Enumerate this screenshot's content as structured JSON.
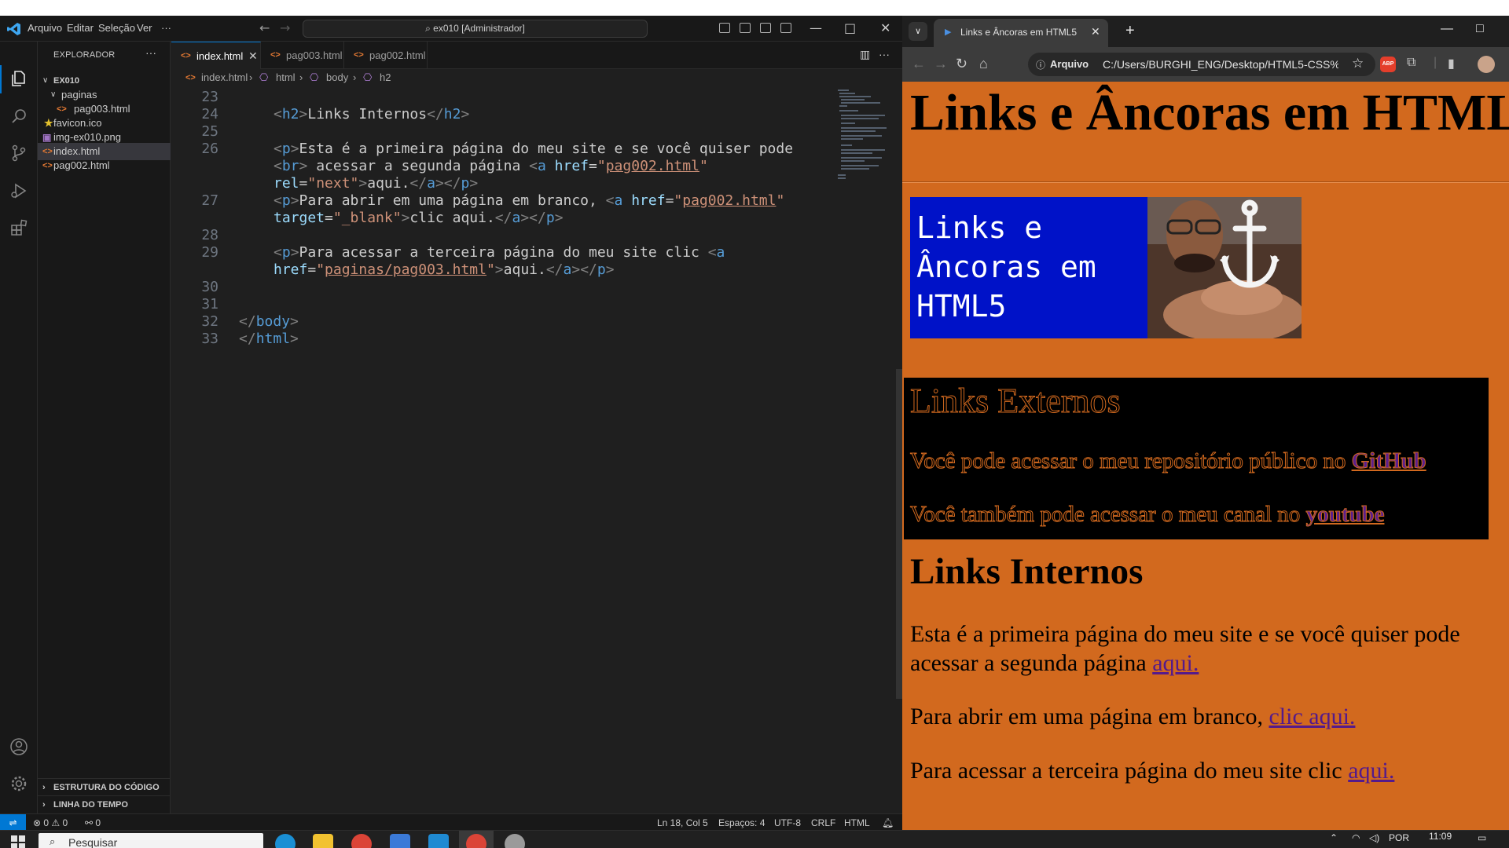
{
  "vscode": {
    "menus": [
      "Arquivo",
      "Editar",
      "Seleção",
      "Ver",
      "···"
    ],
    "search_text": "ex010 [Administrador]",
    "sidebar": {
      "title": "EXPLORADOR",
      "more": "···",
      "folder": "EX010",
      "tree": [
        {
          "label": "paginas",
          "kind": "folder"
        },
        {
          "label": "pag003.html",
          "kind": "html"
        },
        {
          "label": "favicon.ico",
          "kind": "ico"
        },
        {
          "label": "img-ex010.png",
          "kind": "image"
        },
        {
          "label": "index.html",
          "kind": "html",
          "selected": true
        },
        {
          "label": "pag002.html",
          "kind": "html"
        }
      ],
      "sections": [
        "ESTRUTURA DO CÓDIGO",
        "LINHA DO TEMPO"
      ]
    },
    "tabs": [
      "index.html",
      "pag003.html",
      "pag002.html"
    ],
    "breadcrumb": [
      "index.html",
      "html",
      "body",
      "h2"
    ],
    "line_numbers": [
      "23",
      "24",
      "25",
      "26",
      "",
      "",
      "27",
      "",
      "28",
      "29",
      "",
      "30",
      "31",
      "32",
      "33"
    ],
    "status": {
      "problems": "⊗ 0 ⚠ 0",
      "ports": "⚯ 0",
      "position": "Ln 18, Col 5",
      "spaces": "Espaços: 4",
      "encoding": "UTF-8",
      "eol": "CRLF",
      "language": "HTML"
    },
    "accent": "#0078d4"
  },
  "chrome": {
    "tab_title": "Links e Âncoras em HTML5",
    "omnibox_scheme": "Arquivo",
    "omnibox_url": "C:/Users/BURGHI_ENG/Desktop/HTML5-CSS%2...",
    "abp_label": "ABP",
    "page": {
      "h1": "Links e Âncoras em HTML",
      "banner_text": "Links e\nÂncoras em\nHTML5",
      "ext_title": "Links Externos",
      "ext_p1": "Você pode acessar o meu repositório público no ",
      "ext_p1_link": "GitHub",
      "ext_p2": "Você também pode acessar o meu canal no ",
      "ext_p2_link": "youtube",
      "int_title": "Links Internos",
      "p1a": "Esta é a primeira página do meu site e se você quiser pode",
      "p1b": "acessar a segunda página ",
      "p1_link": "aqui.",
      "p2": "Para abrir em uma página em branco, ",
      "p2_link": "clic aqui.",
      "p3": "Para acessar a terceira página do meu site clic ",
      "p3_link": "aqui."
    },
    "page_bg": "#d2691e"
  },
  "taskbar": {
    "search_placeholder": "Pesquisar",
    "language": "POR",
    "time": "11:09"
  }
}
